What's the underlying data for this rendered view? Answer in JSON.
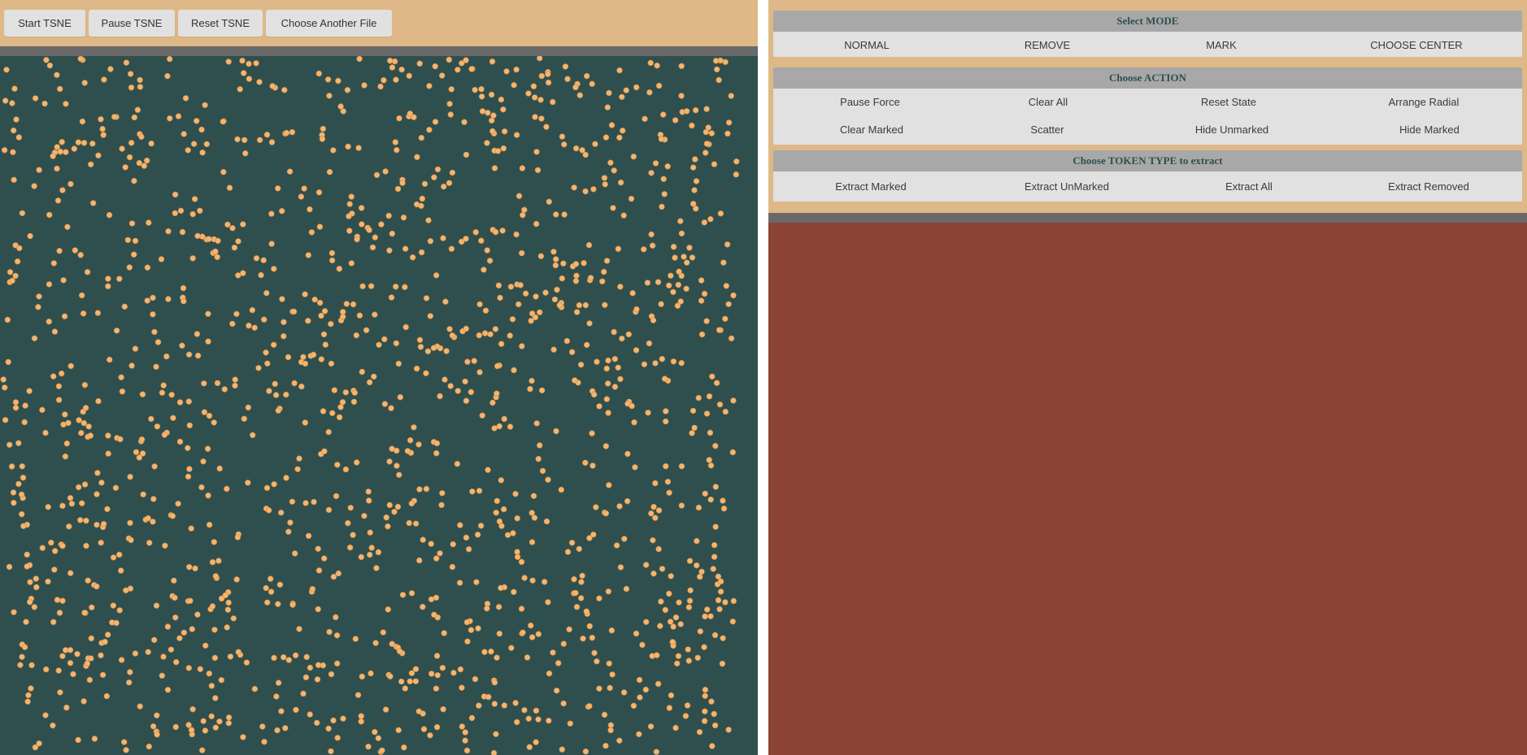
{
  "colors": {
    "accent": "#deb887",
    "canvas_bg": "#2f4f4f",
    "separator": "#696969",
    "right_bg": "#8b4333",
    "button_bg": "#e1e1e1",
    "header_bg": "#a8a8a8",
    "dot": "#f4b56f"
  },
  "toolbar": {
    "start_label": "Start TSNE",
    "pause_label": "Pause TSNE",
    "reset_label": "Reset TSNE",
    "choose_file_label": "Choose Another File"
  },
  "mode": {
    "header_prefix": "Select ",
    "header_emph": "MODE",
    "items": [
      "NORMAL",
      "REMOVE",
      "MARK",
      "CHOOSE CENTER"
    ]
  },
  "action": {
    "header_prefix": "Choose ",
    "header_emph": "ACTION",
    "row1": [
      "Pause Force",
      "Clear All",
      "Reset State",
      "Arrange Radial"
    ],
    "row2": [
      "Clear Marked",
      "Scatter",
      "Hide Unmarked",
      "Hide Marked"
    ]
  },
  "token": {
    "header_prefix": "Choose ",
    "header_emph": "TOKEN TYPE",
    "header_suffix": " to extract",
    "items": [
      "Extract Marked",
      "Extract UnMarked",
      "Extract All",
      "Extract Removed"
    ]
  }
}
